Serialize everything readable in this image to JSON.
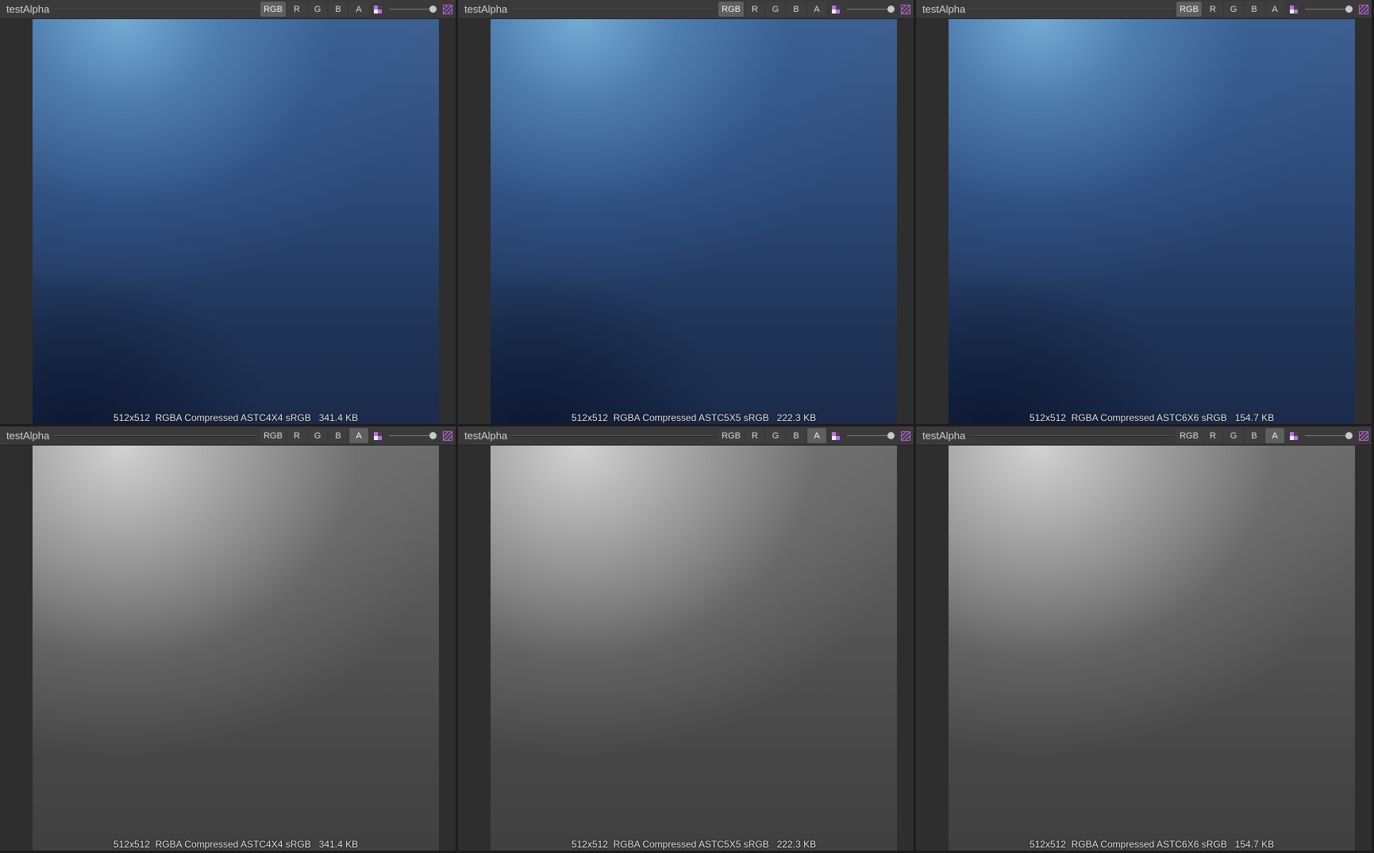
{
  "panels": [
    {
      "title": "testAlpha",
      "mode": "rgb",
      "info": "512x512  RGBA Compressed ASTC4X4 sRGB   341.4 KB",
      "active_channel": "RGB",
      "channels": [
        "RGB",
        "R",
        "G",
        "B",
        "A"
      ]
    },
    {
      "title": "testAlpha",
      "mode": "rgb",
      "info": "512x512  RGBA Compressed ASTC5X5 sRGB   222.3 KB",
      "active_channel": "RGB",
      "channels": [
        "RGB",
        "R",
        "G",
        "B",
        "A"
      ]
    },
    {
      "title": "testAlpha",
      "mode": "rgb",
      "info": "512x512  RGBA Compressed ASTC6X6 sRGB   154.7 KB",
      "active_channel": "RGB",
      "channels": [
        "RGB",
        "R",
        "G",
        "B",
        "A"
      ]
    },
    {
      "title": "testAlpha",
      "mode": "alpha",
      "info": "512x512  RGBA Compressed ASTC4X4 sRGB   341.4 KB",
      "active_channel": "A",
      "channels": [
        "RGB",
        "R",
        "G",
        "B",
        "A"
      ]
    },
    {
      "title": "testAlpha",
      "mode": "alpha",
      "info": "512x512  RGBA Compressed ASTC5X5 sRGB   222.3 KB",
      "active_channel": "A",
      "channels": [
        "RGB",
        "R",
        "G",
        "B",
        "A"
      ]
    },
    {
      "title": "testAlpha",
      "mode": "alpha",
      "info": "512x512  RGBA Compressed ASTC6X6 sRGB   154.7 KB",
      "active_channel": "A",
      "channels": [
        "RGB",
        "R",
        "G",
        "B",
        "A"
      ]
    }
  ],
  "mip_slider_value": 1.0,
  "icons": {
    "color_swatch": "color-swatch-icon",
    "transparency": "transparency-checker-icon"
  },
  "colors": {
    "accent_icon": "#b060d0",
    "toolbar_bg": "#3a3a3a",
    "panel_bg": "#2e2e2e"
  }
}
